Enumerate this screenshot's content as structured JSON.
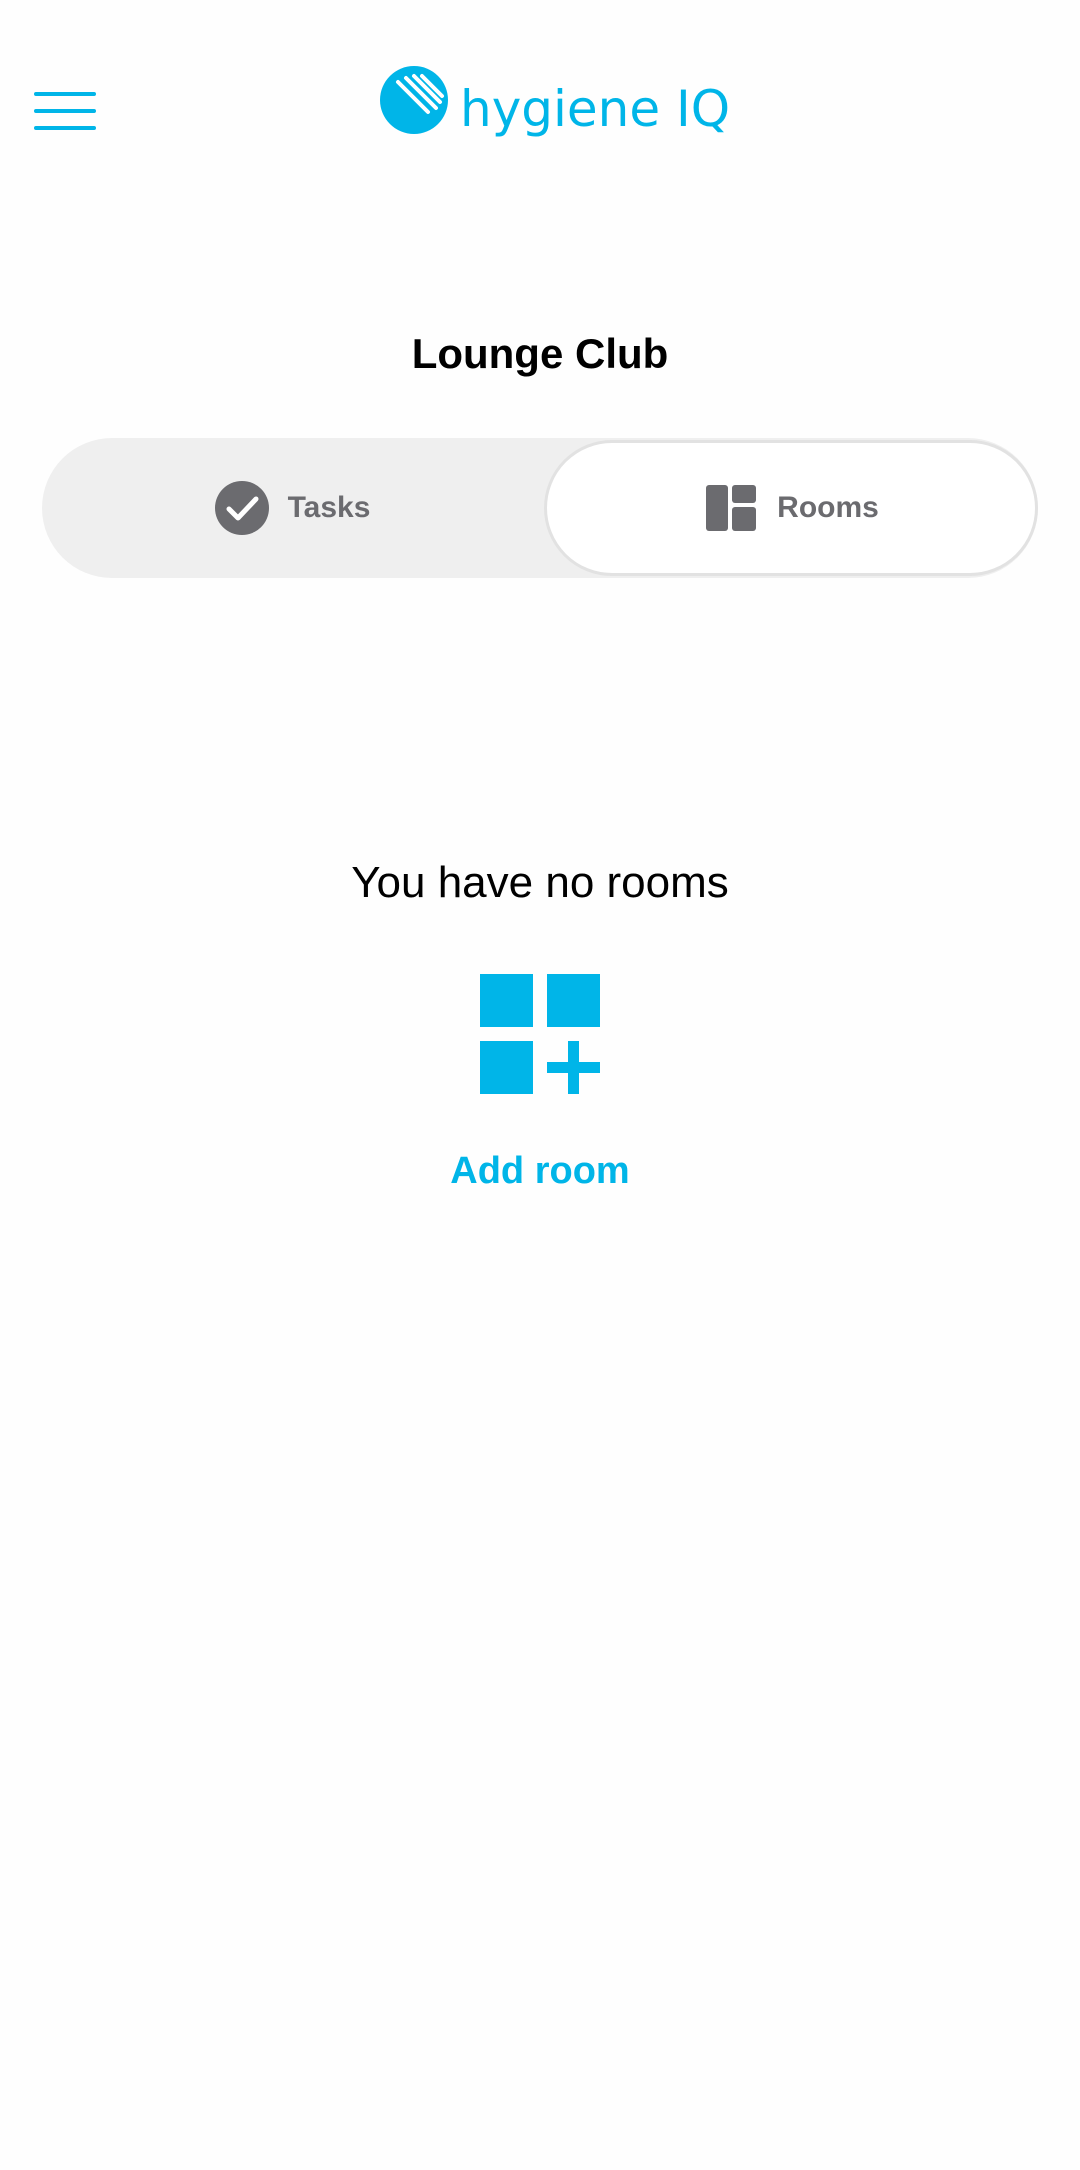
{
  "header": {
    "menu_icon": "hamburger-menu-icon",
    "logo_text": "hygiene IQ",
    "brand_color": "#00b5e8"
  },
  "page": {
    "title": "Lounge Club"
  },
  "tabs": [
    {
      "label": "Tasks",
      "icon": "check-circle-icon",
      "selected": false
    },
    {
      "label": "Rooms",
      "icon": "rooms-layout-icon",
      "selected": true
    }
  ],
  "empty_state": {
    "message": "You have no rooms",
    "icon": "add-room-grid-icon",
    "action_label": "Add room"
  },
  "colors": {
    "accent": "#00b5e8",
    "tab_text": "#6b6b6f",
    "segment_bg": "#efefef"
  }
}
